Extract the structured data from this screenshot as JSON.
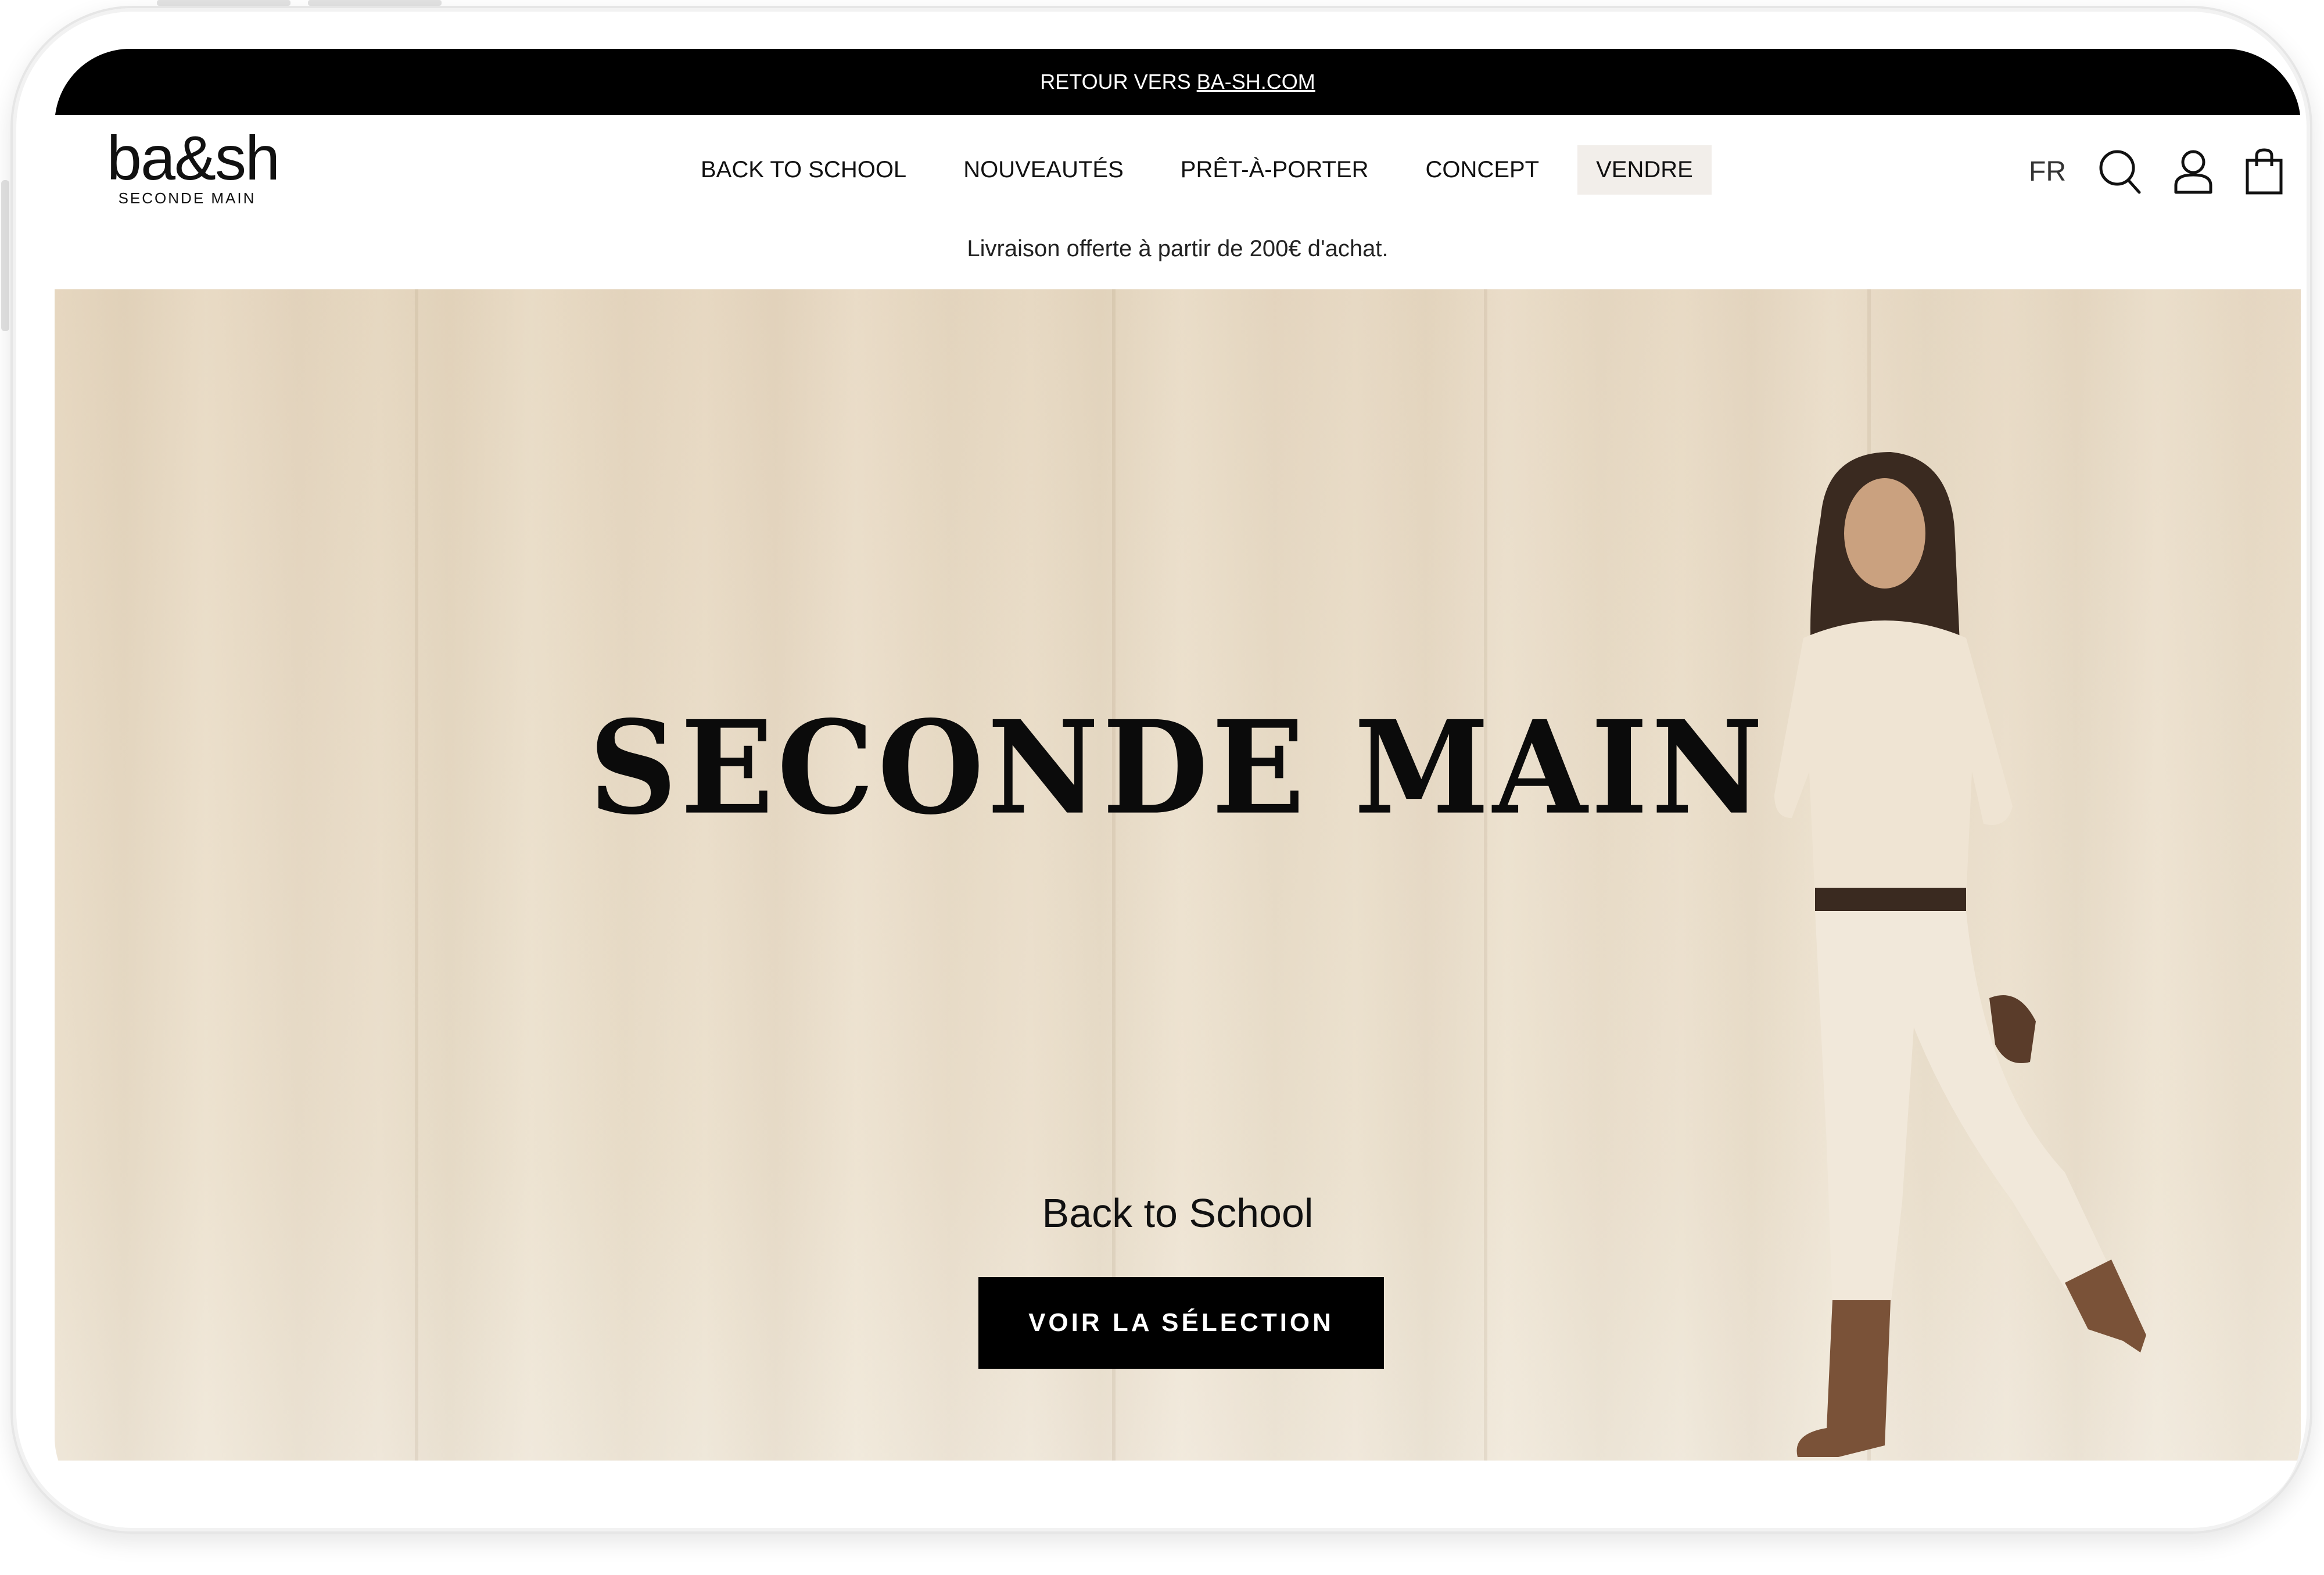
{
  "topbar": {
    "prefix": "RETOUR VERS",
    "link": "BA-SH.COM"
  },
  "header": {
    "logo_word": "ba&sh",
    "logo_sub": "SECONDE MAIN",
    "nav": [
      {
        "label": "BACK TO SCHOOL"
      },
      {
        "label": "NOUVEAUTÉS"
      },
      {
        "label": "PRÊT-À-PORTER"
      },
      {
        "label": "CONCEPT"
      },
      {
        "label": "VENDRE"
      }
    ],
    "language": "FR",
    "icons": [
      "search-icon",
      "account-icon",
      "bag-icon"
    ]
  },
  "promo": {
    "text": "Livraison offerte à partir de 200€ d'achat."
  },
  "hero": {
    "title": "SECONDE MAIN",
    "subtitle": "Back to School",
    "cta_label": "VOIR LA SÉLECTION"
  },
  "colors": {
    "topbar_bg": "#000000",
    "hero_bg": "#e8dac4",
    "cta_bg": "#000000",
    "nav_highlight_bg": "#f2eeea"
  }
}
